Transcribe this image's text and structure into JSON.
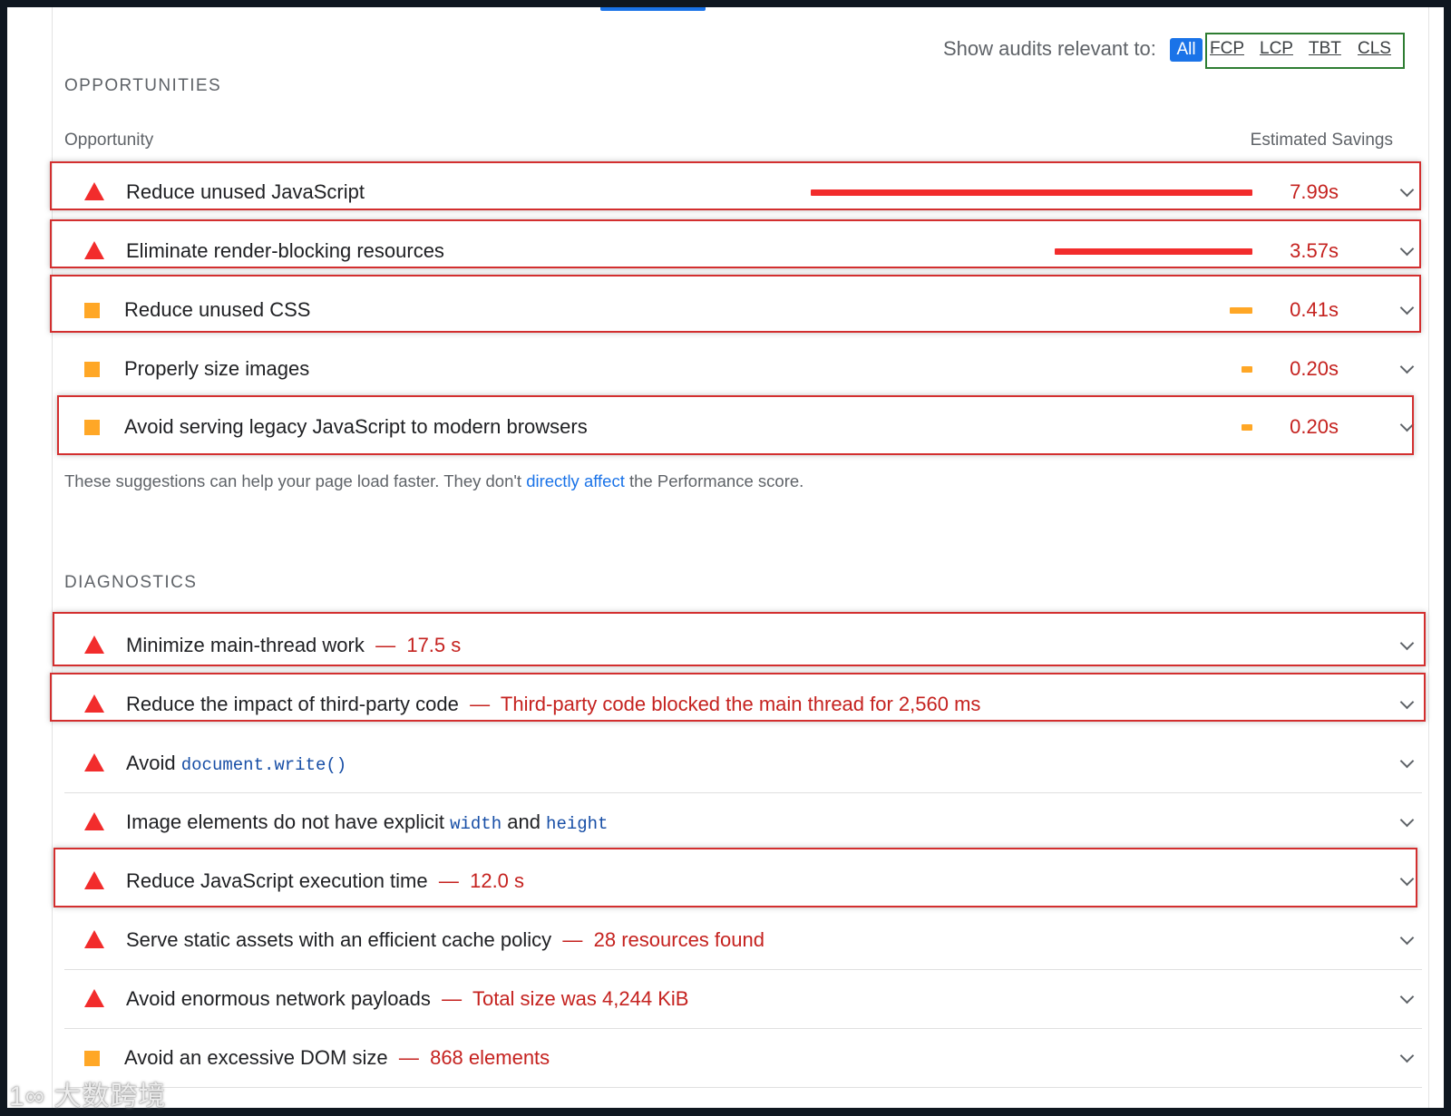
{
  "filter": {
    "label": "Show audits relevant to:",
    "all": "All",
    "metrics": [
      "FCP",
      "LCP",
      "TBT",
      "CLS"
    ]
  },
  "opportunities": {
    "title": "OPPORTUNITIES",
    "col_opportunity": "Opportunity",
    "col_savings": "Estimated Savings",
    "items": [
      {
        "title": "Reduce unused JavaScript",
        "savings": "7.99s",
        "bar_fraction": 1.0,
        "severity": "fail"
      },
      {
        "title": "Eliminate render-blocking resources",
        "savings": "3.57s",
        "bar_fraction": 0.447,
        "severity": "fail"
      },
      {
        "title": "Reduce unused CSS",
        "savings": "0.41s",
        "bar_fraction": 0.051,
        "severity": "average"
      },
      {
        "title": "Properly size images",
        "savings": "0.20s",
        "bar_fraction": 0.025,
        "severity": "average"
      },
      {
        "title": "Avoid serving legacy JavaScript to modern browsers",
        "savings": "0.20s",
        "bar_fraction": 0.025,
        "severity": "average"
      }
    ],
    "note": {
      "before": "These suggestions can help your page load faster. They don't ",
      "link": "directly affect",
      "after": " the Performance score."
    }
  },
  "diagnostics": {
    "title": "DIAGNOSTICS",
    "items": [
      {
        "title": "Minimize main-thread work",
        "display": "17.5 s"
      },
      {
        "title": "Reduce the impact of third-party code",
        "display": "Third-party code blocked the main thread for 2,560 ms"
      },
      {
        "title_before": "Avoid ",
        "code": "document.write()"
      },
      {
        "title_before": "Image elements do not have explicit ",
        "code1": "width",
        "middle": " and ",
        "code2": "height"
      },
      {
        "title": "Reduce JavaScript execution time",
        "display": "12.0 s"
      },
      {
        "title": "Serve static assets with an efficient cache policy",
        "display": "28 resources found"
      },
      {
        "title": "Avoid enormous network payloads",
        "display": "Total size was 4,244 KiB"
      },
      {
        "title": "Avoid an excessive DOM size",
        "display": "868 elements"
      }
    ],
    "dash": "—"
  },
  "colors": {
    "fail": "#f22c2c",
    "average": "#ffa726",
    "accent": "#1a73e8",
    "highlight_red": "#d32f2f",
    "highlight_green": "#2e7d32"
  },
  "watermark": "大数跨境"
}
